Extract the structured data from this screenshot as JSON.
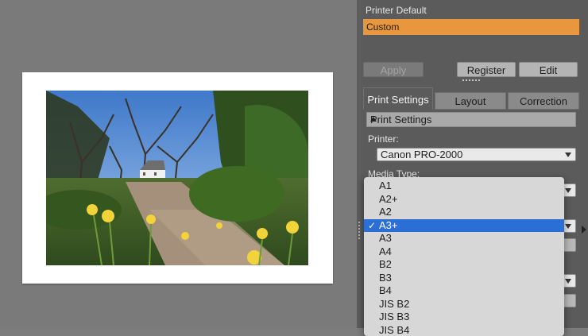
{
  "printer_presets": {
    "items": [
      "Printer Default",
      "Custom"
    ],
    "selected": "Custom"
  },
  "preset_buttons": {
    "apply": "Apply",
    "register": "Register",
    "edit": "Edit"
  },
  "tabs": [
    "Print Settings",
    "Layout",
    "Correction"
  ],
  "active_tab": "Print Settings",
  "section": {
    "title": "Print Settings"
  },
  "printer": {
    "label": "Printer:",
    "value": "Canon PRO-2000"
  },
  "media_type": {
    "label": "Media Type:"
  },
  "paper_size_dropdown": {
    "options": [
      "A1",
      "A2+",
      "A2",
      "A3+",
      "A3",
      "A4",
      "B2",
      "B3",
      "B4",
      "JIS B2",
      "JIS B3",
      "JIS B4"
    ],
    "selected": "A3+",
    "check_glyph": "✓"
  },
  "colors": {
    "accent_selected_preset": "#e9973f",
    "selection_blue": "#2b6fd6"
  }
}
